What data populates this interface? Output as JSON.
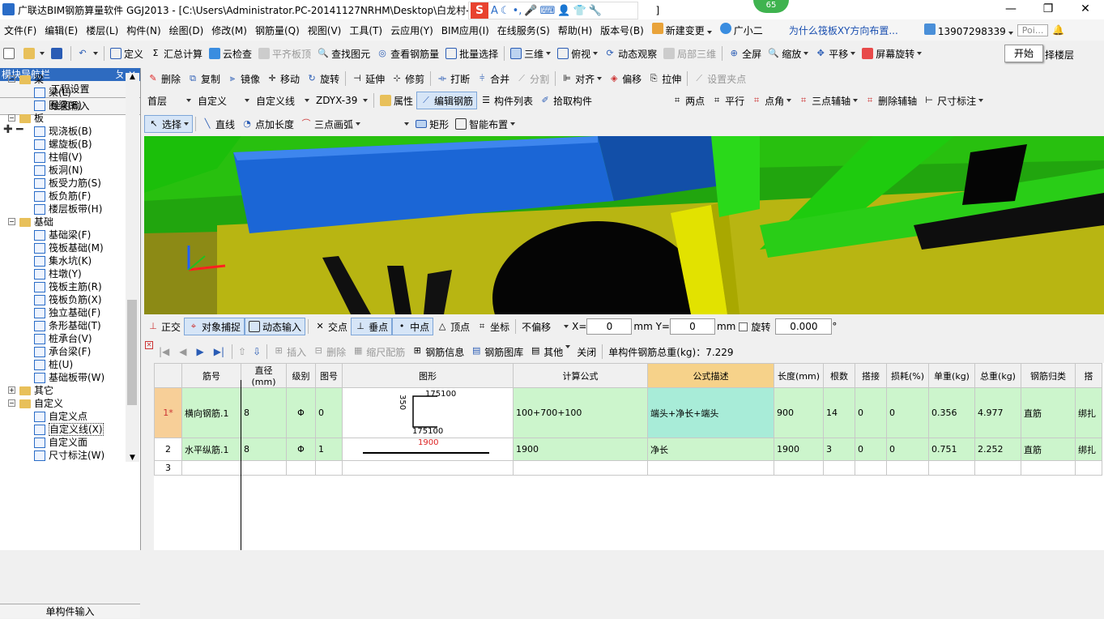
{
  "window": {
    "title": "广联达BIM钢筋算量软件 GGJ2013 - [C:\\Users\\Administrator.PC-20141127NRHM\\Desktop\\白龙村-",
    "title_end": "]",
    "badge": "65",
    "min": "—",
    "restore": "❐",
    "close": "✕"
  },
  "menu": [
    "文件(F)",
    "编辑(E)",
    "楼层(L)",
    "构件(N)",
    "绘图(D)",
    "修改(M)",
    "钢筋量(Q)",
    "视图(V)",
    "工具(T)",
    "云应用(Y)",
    "BIM应用(I)",
    "在线服务(S)",
    "帮助(H)",
    "版本号(B)",
    "新建变更",
    "广小二",
    "为什么筏板XY方向布置...",
    "13907298339",
    "Poi...",
    "开始"
  ],
  "toolbar1": [
    "定义",
    "汇总计算",
    "云检查",
    "平齐板顶",
    "查找图元",
    "查看钢筋量",
    "批量选择",
    "三维",
    "俯视",
    "动态观察",
    "局部三维",
    "全屏",
    "缩放",
    "平移",
    "屏幕旋转",
    "择楼层"
  ],
  "toolbar2": [
    "删除",
    "复制",
    "镜像",
    "移动",
    "旋转",
    "延伸",
    "修剪",
    "打断",
    "合并",
    "分割",
    "对齐",
    "偏移",
    "拉伸",
    "设置夹点"
  ],
  "toolbar3": {
    "floor": "首层",
    "type": "自定义",
    "line": "自定义线",
    "code": "ZDYX-39",
    "items": [
      "属性",
      "编辑钢筋",
      "构件列表",
      "拾取构件"
    ],
    "axis": [
      "两点",
      "平行",
      "点角",
      "三点辅轴",
      "删除辅轴",
      "尺寸标注"
    ]
  },
  "toolbar4": [
    "选择",
    "直线",
    "点加长度",
    "三点画弧",
    "矩形",
    "智能布置"
  ],
  "sidebar": {
    "header": "模块导航栏",
    "pin": "ㄆ",
    "close": "✕",
    "btn1": "工程设置",
    "btn2": "绘图输入",
    "footer": "单构件输入",
    "tree": [
      {
        "t": "梁",
        "lvl": 0,
        "f": true
      },
      {
        "t": "梁(L)",
        "lvl": 1
      },
      {
        "t": "圈梁(E)",
        "lvl": 1
      },
      {
        "t": "板",
        "lvl": 0,
        "f": true
      },
      {
        "t": "现浇板(B)",
        "lvl": 1
      },
      {
        "t": "螺旋板(B)",
        "lvl": 1
      },
      {
        "t": "柱帽(V)",
        "lvl": 1
      },
      {
        "t": "板洞(N)",
        "lvl": 1
      },
      {
        "t": "板受力筋(S)",
        "lvl": 1
      },
      {
        "t": "板负筋(F)",
        "lvl": 1
      },
      {
        "t": "楼层板带(H)",
        "lvl": 1
      },
      {
        "t": "基础",
        "lvl": 0,
        "f": true
      },
      {
        "t": "基础梁(F)",
        "lvl": 1
      },
      {
        "t": "筏板基础(M)",
        "lvl": 1
      },
      {
        "t": "集水坑(K)",
        "lvl": 1
      },
      {
        "t": "柱墩(Y)",
        "lvl": 1
      },
      {
        "t": "筏板主筋(R)",
        "lvl": 1
      },
      {
        "t": "筏板负筋(X)",
        "lvl": 1
      },
      {
        "t": "独立基础(F)",
        "lvl": 1
      },
      {
        "t": "条形基础(T)",
        "lvl": 1
      },
      {
        "t": "桩承台(V)",
        "lvl": 1
      },
      {
        "t": "承台梁(F)",
        "lvl": 1
      },
      {
        "t": "桩(U)",
        "lvl": 1
      },
      {
        "t": "基础板带(W)",
        "lvl": 1
      },
      {
        "t": "其它",
        "lvl": 0,
        "f": true,
        "c": true
      },
      {
        "t": "自定义",
        "lvl": 0,
        "f": true
      },
      {
        "t": "自定义点",
        "lvl": 1
      },
      {
        "t": "自定义线(X)",
        "lvl": 1,
        "sel": true
      },
      {
        "t": "自定义面",
        "lvl": 1
      },
      {
        "t": "尺寸标注(W)",
        "lvl": 1
      }
    ]
  },
  "snap": {
    "items": [
      "正交",
      "对象捕捉",
      "动态输入",
      "交点",
      "垂点",
      "中点",
      "顶点",
      "坐标"
    ],
    "offset": "不偏移",
    "x_label": "X=",
    "x": "0",
    "y_label": "mm Y=",
    "y": "0",
    "unit": "mm",
    "rotate": "旋转",
    "angle": "0.000",
    "deg": "°"
  },
  "gridtb": {
    "items": [
      "插入",
      "删除",
      "缩尺配筋",
      "钢筋信息",
      "钢筋图库",
      "其他",
      "关闭"
    ],
    "total": "单构件钢筋总重(kg)：7.229"
  },
  "table": {
    "headers": [
      "",
      "筋号",
      "直径(mm)",
      "级别",
      "图号",
      "图形",
      "计算公式",
      "公式描述",
      "长度(mm)",
      "根数",
      "搭接",
      "损耗(%)",
      "单重(kg)",
      "总重(kg)",
      "钢筋归类",
      "搭"
    ],
    "rows": [
      {
        "no": "1*",
        "name": "横向钢筋.1",
        "dia": "8",
        "grade": "Φ",
        "fig": "0",
        "shape_a": "175",
        "shape_b": "100",
        "shape_h": "350",
        "shape_c": "175",
        "shape_d": "100",
        "formula": "100+700+100",
        "desc": "端头+净长+端头",
        "len": "900",
        "count": "14",
        "lap": "0",
        "loss": "0",
        "unit_w": "0.356",
        "total_w": "4.977",
        "cls": "直筋",
        "extra": "绑扎"
      },
      {
        "no": "2",
        "name": "水平纵筋.1",
        "dia": "8",
        "grade": "Φ",
        "fig": "1",
        "shape_len": "1900",
        "formula": "1900",
        "desc": "净长",
        "len": "1900",
        "count": "3",
        "lap": "0",
        "loss": "0",
        "unit_w": "0.751",
        "total_w": "2.252",
        "cls": "直筋",
        "extra": "绑扎"
      },
      {
        "no": "3"
      }
    ]
  },
  "colors": {
    "accent": "#2e6bc0",
    "green3d": "#2a9a14",
    "blue3d": "#1d64d8",
    "yellow3d": "#c8c400"
  }
}
